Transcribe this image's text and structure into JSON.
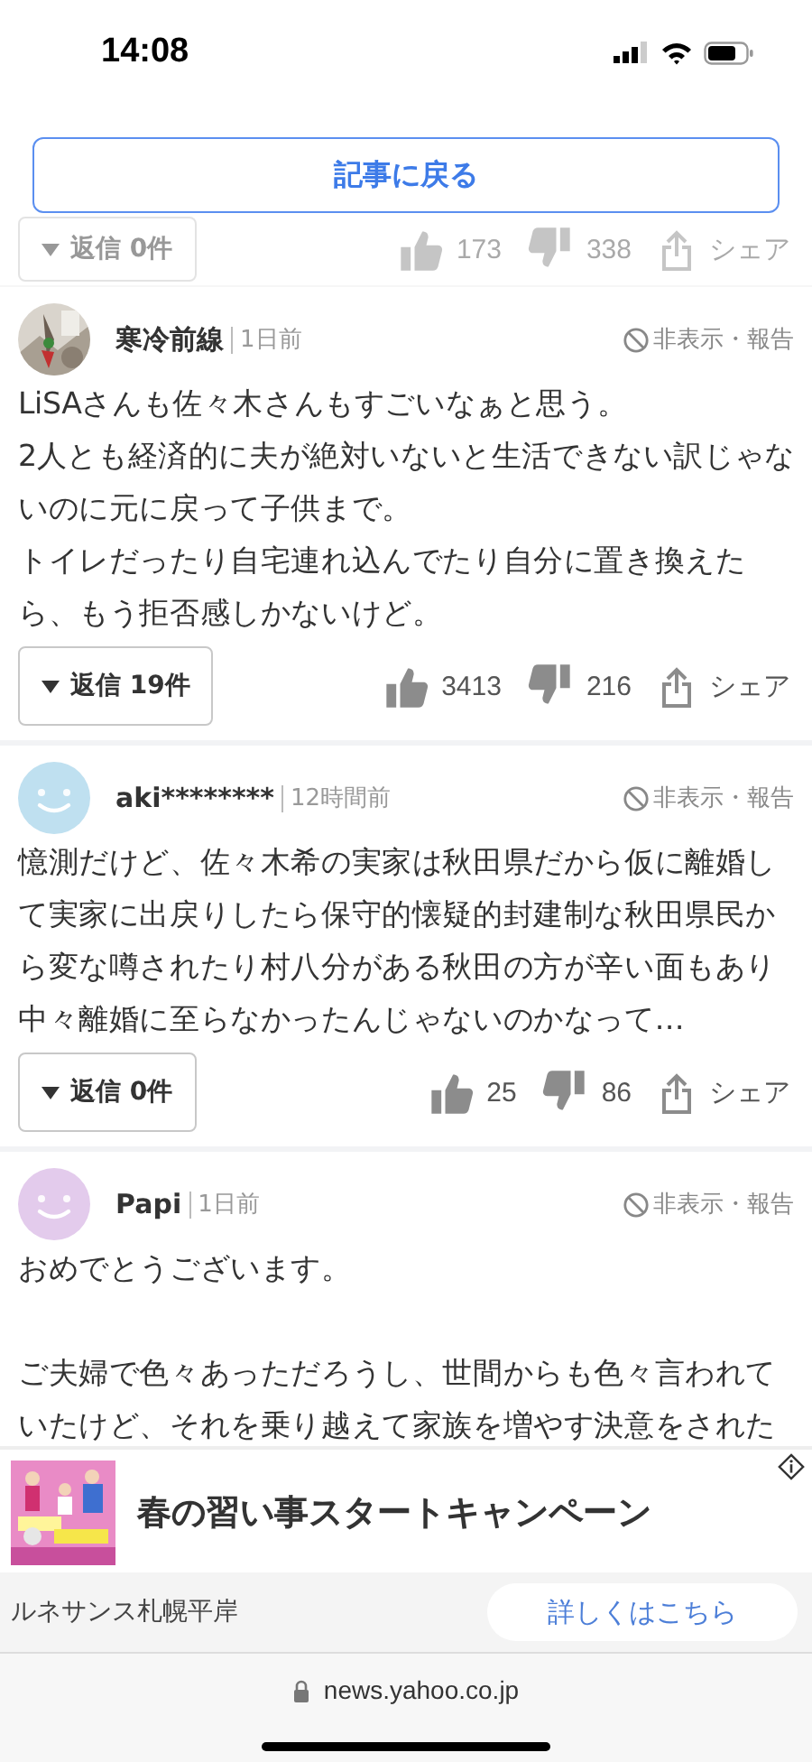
{
  "status_bar": {
    "time": "14:08"
  },
  "back_button": {
    "label": "記事に戻る"
  },
  "partial_actions": {
    "replies": "返信 0件",
    "likes": "173",
    "dislikes": "338",
    "share": "シェア"
  },
  "comments": [
    {
      "avatar": {
        "kind": "picture"
      },
      "name": "寒冷前線",
      "time": "1日前",
      "hide_report": "非表示・報告",
      "paragraphs": [
        [
          "LiSAさんも佐々木さんもすごいなぁと思う。",
          "2人とも経済的に夫が絶対いないと生活できない訳じゃないのに元に戻って子供まで。",
          "トイレだったり自宅連れ込んでたり自分に置き換えたら、もう拒否感しかないけど。"
        ]
      ],
      "actions": {
        "replies": "返信 19件",
        "likes": "3413",
        "dislikes": "216",
        "share": "シェア"
      }
    },
    {
      "avatar": {
        "kind": "smiley",
        "color": "#bfe0f0"
      },
      "name": "aki********",
      "time": "12時間前",
      "hide_report": "非表示・報告",
      "paragraphs": [
        [
          "憶測だけど、佐々木希の実家は秋田県だから仮に離婚して実家に出戻りしたら保守的懐疑的封建制な秋田県民から変な噂されたり村八分がある秋田の方が辛い面もあり中々離婚に至らなかったんじゃないのかなって…"
        ]
      ],
      "actions": {
        "replies": "返信 0件",
        "likes": "25",
        "dislikes": "86",
        "share": "シェア"
      }
    },
    {
      "avatar": {
        "kind": "smiley",
        "color": "#e3cbec"
      },
      "name": "Papi",
      "time": "1日前",
      "hide_report": "非表示・報告",
      "paragraphs": [
        [
          "おめでとうございます。"
        ],
        [
          "ご夫婦で色々あっただろうし、世間からも色々言われていたけど、それを乗り越えて家族を増やす決意をされた"
        ]
      ]
    }
  ],
  "ad": {
    "title": "春の習い事スタートキャンペーン",
    "advertiser": "ルネサンス札幌平岸",
    "cta": "詳しくはこちら"
  },
  "browser": {
    "url": "news.yahoo.co.jp"
  }
}
